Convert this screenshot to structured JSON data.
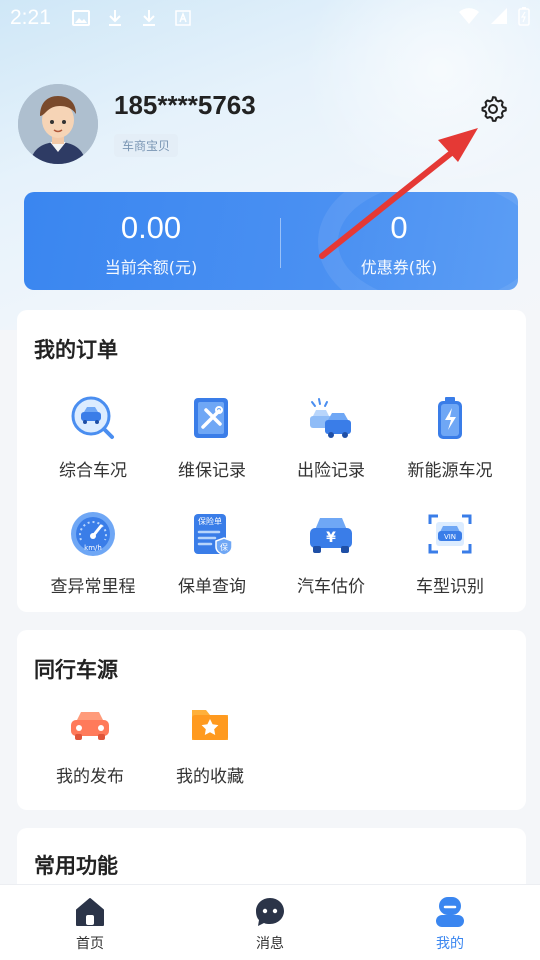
{
  "status_bar": {
    "time": "2:21"
  },
  "profile": {
    "phone": "185****5763",
    "tag": "车商宝贝"
  },
  "balance": [
    {
      "value": "0.00",
      "label": "当前余额(元)"
    },
    {
      "value": "0",
      "label": "优惠券(张)"
    }
  ],
  "orders": {
    "title": "我的订单",
    "items": [
      {
        "label": "综合车况",
        "icon": "car-search-icon"
      },
      {
        "label": "维保记录",
        "icon": "repair-tools-icon"
      },
      {
        "label": "出险记录",
        "icon": "car-accident-icon"
      },
      {
        "label": "新能源车况",
        "icon": "battery-icon"
      },
      {
        "label": "查异常里程",
        "icon": "speedometer-icon"
      },
      {
        "label": "保单查询",
        "icon": "policy-icon"
      },
      {
        "label": "汽车估价",
        "icon": "car-price-icon"
      },
      {
        "label": "车型识别",
        "icon": "vin-scan-icon"
      }
    ],
    "speedometer_unit": "km/h",
    "policy_text": "保险单",
    "policy_badge": "保",
    "price_symbol": "¥",
    "vin_text": "VIN"
  },
  "peer_sources": {
    "title": "同行车源",
    "items": [
      {
        "label": "我的发布",
        "icon": "car-icon"
      },
      {
        "label": "我的收藏",
        "icon": "folder-star-icon"
      }
    ]
  },
  "common": {
    "title": "常用功能"
  },
  "tabbar": {
    "items": [
      {
        "label": "首页",
        "icon": "home-icon"
      },
      {
        "label": "消息",
        "icon": "message-icon"
      },
      {
        "label": "我的",
        "icon": "profile-icon"
      }
    ],
    "active": "我的"
  },
  "colors": {
    "accent": "#3a86f0",
    "annotation_arrow": "#e53935"
  }
}
